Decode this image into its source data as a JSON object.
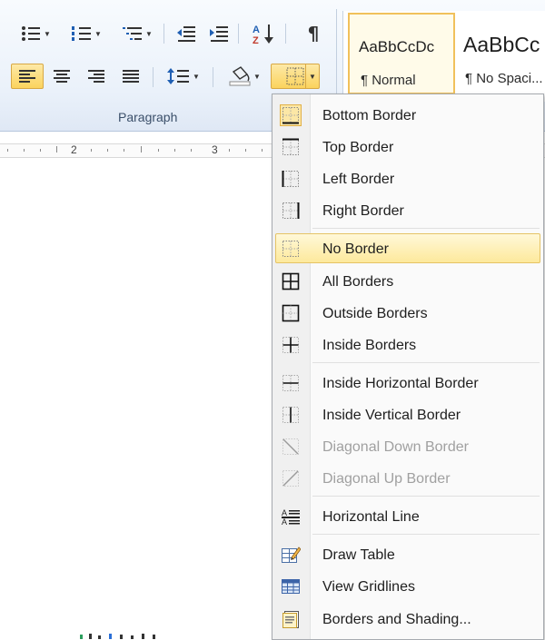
{
  "ribbon": {
    "group_label": "Paragraph",
    "styles": [
      {
        "sample": "AaBbCcDc",
        "name": "¶ Normal"
      },
      {
        "sample": "AaBbCc",
        "name": "¶ No Spaci..."
      }
    ]
  },
  "ruler": {
    "numbers": [
      "2",
      "3"
    ]
  },
  "menu": {
    "items": [
      {
        "label": "Bottom Border",
        "icon": "bottom-border-icon"
      },
      {
        "label": "Top Border",
        "icon": "top-border-icon"
      },
      {
        "label": "Left Border",
        "icon": "left-border-icon"
      },
      {
        "label": "Right Border",
        "icon": "right-border-icon"
      },
      {
        "label": "No Border",
        "icon": "no-border-icon"
      },
      {
        "label": "All Borders",
        "icon": "all-borders-icon"
      },
      {
        "label": "Outside Borders",
        "icon": "outside-borders-icon"
      },
      {
        "label": "Inside Borders",
        "icon": "inside-borders-icon"
      },
      {
        "label": "Inside Horizontal Border",
        "icon": "inside-horizontal-border-icon"
      },
      {
        "label": "Inside Vertical Border",
        "icon": "inside-vertical-border-icon"
      },
      {
        "label": "Diagonal Down Border",
        "icon": "diagonal-down-border-icon"
      },
      {
        "label": "Diagonal Up Border",
        "icon": "diagonal-up-border-icon"
      },
      {
        "label": "Horizontal Line",
        "icon": "horizontal-line-icon"
      },
      {
        "label": "Draw Table",
        "icon": "draw-table-icon"
      },
      {
        "label": "View Gridlines",
        "icon": "view-gridlines-icon"
      },
      {
        "label": "Borders and Shading...",
        "icon": "borders-shading-icon"
      }
    ],
    "checked_item": "Bottom Border",
    "highlighted_item": "No Border",
    "disabled_items": [
      "Diagonal Down Border",
      "Diagonal Up Border"
    ]
  },
  "colors": {
    "highlight": "#fde99c",
    "ribbon_bg": "#eaf1fa",
    "active_button": "#fbd35d"
  }
}
